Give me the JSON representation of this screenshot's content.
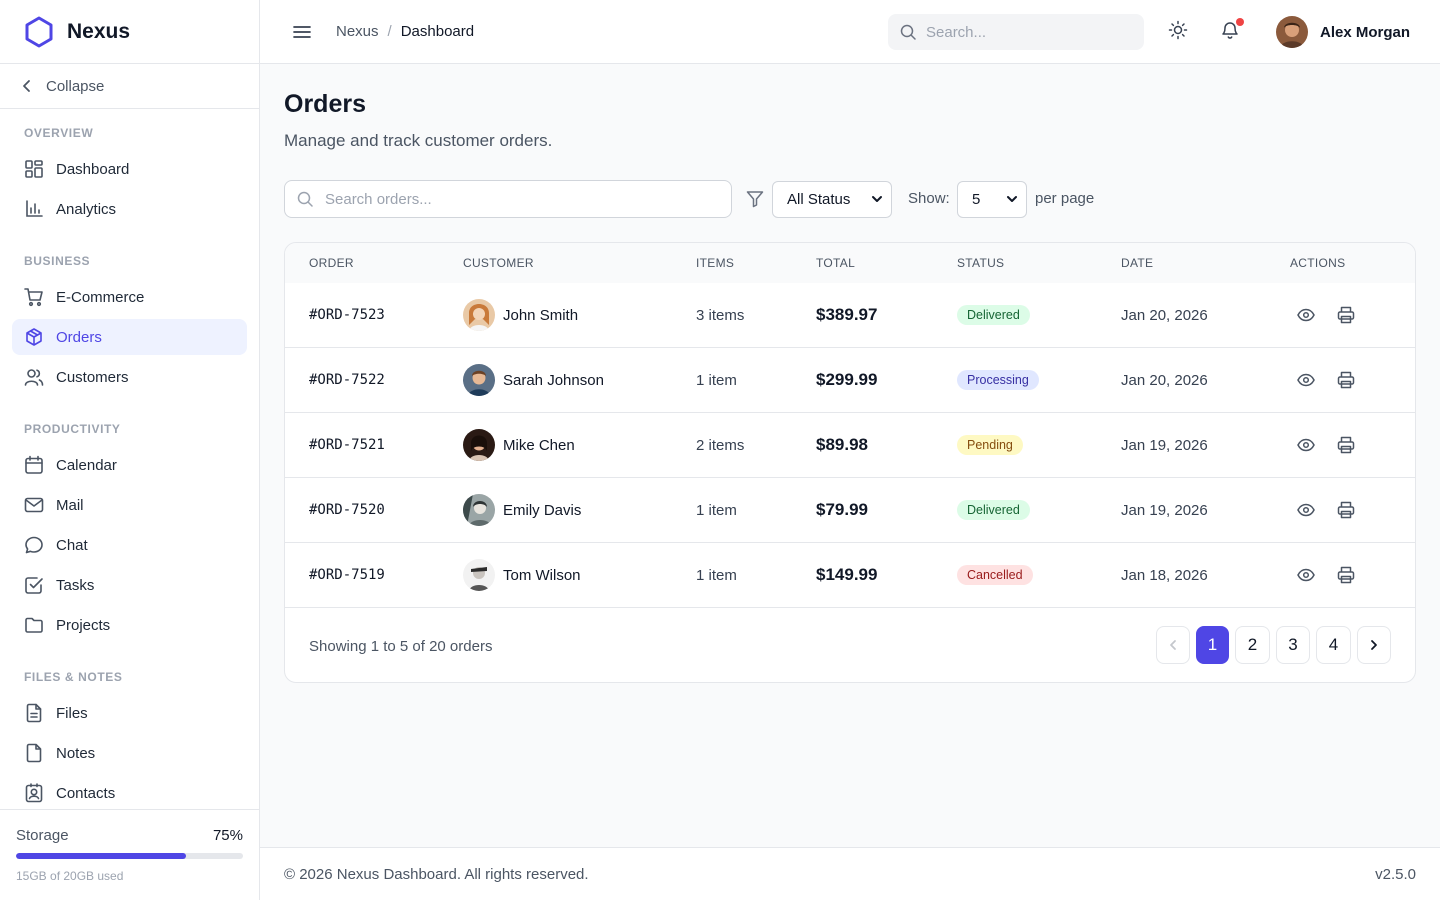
{
  "brand": {
    "name": "Nexus",
    "logo_color": "#4f46e5"
  },
  "sidebar": {
    "collapse_label": "Collapse",
    "sections": [
      {
        "title": "OVERVIEW",
        "items": [
          {
            "label": "Dashboard",
            "icon": "dashboard-icon"
          },
          {
            "label": "Analytics",
            "icon": "analytics-icon"
          }
        ]
      },
      {
        "title": "BUSINESS",
        "items": [
          {
            "label": "E-Commerce",
            "icon": "cart-icon"
          },
          {
            "label": "Orders",
            "icon": "package-icon",
            "active": true
          },
          {
            "label": "Customers",
            "icon": "users-icon"
          }
        ]
      },
      {
        "title": "PRODUCTIVITY",
        "items": [
          {
            "label": "Calendar",
            "icon": "calendar-icon"
          },
          {
            "label": "Mail",
            "icon": "mail-icon"
          },
          {
            "label": "Chat",
            "icon": "chat-icon"
          },
          {
            "label": "Tasks",
            "icon": "tasks-icon"
          },
          {
            "label": "Projects",
            "icon": "folder-icon"
          }
        ]
      },
      {
        "title": "FILES & NOTES",
        "items": [
          {
            "label": "Files",
            "icon": "file-icon"
          },
          {
            "label": "Notes",
            "icon": "note-icon"
          },
          {
            "label": "Contacts",
            "icon": "contacts-icon"
          }
        ]
      }
    ],
    "storage": {
      "label": "Storage",
      "percent_label": "75%",
      "percent": 75,
      "used_label": "15GB of 20GB used"
    }
  },
  "header": {
    "breadcrumb": [
      "Nexus",
      "Dashboard"
    ],
    "search_placeholder": "Search...",
    "user_name": "Alex Morgan"
  },
  "page": {
    "title": "Orders",
    "subtitle": "Manage and track customer orders.",
    "search_placeholder": "Search orders...",
    "status_filter": "All Status",
    "show_label": "Show:",
    "per_page_value": "5",
    "per_page_label": "per page"
  },
  "table": {
    "columns": [
      "ORDER",
      "CUSTOMER",
      "ITEMS",
      "TOTAL",
      "STATUS",
      "DATE",
      "ACTIONS"
    ],
    "rows": [
      {
        "order": "#ORD-7523",
        "customer": "John Smith",
        "items": "3 items",
        "total": "$389.97",
        "status": "Delivered",
        "date": "Jan 20, 2026"
      },
      {
        "order": "#ORD-7522",
        "customer": "Sarah Johnson",
        "items": "1 item",
        "total": "$299.99",
        "status": "Processing",
        "date": "Jan 20, 2026"
      },
      {
        "order": "#ORD-7521",
        "customer": "Mike Chen",
        "items": "2 items",
        "total": "$89.98",
        "status": "Pending",
        "date": "Jan 19, 2026"
      },
      {
        "order": "#ORD-7520",
        "customer": "Emily Davis",
        "items": "1 item",
        "total": "$79.99",
        "status": "Delivered",
        "date": "Jan 19, 2026"
      },
      {
        "order": "#ORD-7519",
        "customer": "Tom Wilson",
        "items": "1 item",
        "total": "$149.99",
        "status": "Cancelled",
        "date": "Jan 18, 2026"
      }
    ],
    "status_colors": {
      "Delivered": {
        "bg": "#dcfce7",
        "fg": "#166534"
      },
      "Processing": {
        "bg": "#e0e7ff",
        "fg": "#3730a3"
      },
      "Pending": {
        "bg": "#fef9c3",
        "fg": "#854d0e"
      },
      "Cancelled": {
        "bg": "#fee2e2",
        "fg": "#991b1b"
      }
    },
    "showing_text": "Showing 1 to 5 of 20 orders",
    "pages": [
      "1",
      "2",
      "3",
      "4"
    ],
    "current_page": "1"
  },
  "footer": {
    "copyright": "© 2026 Nexus Dashboard. All rights reserved.",
    "version": "v2.5.0"
  },
  "colors": {
    "accent": "#4f46e5",
    "notification": "#ef4444"
  }
}
